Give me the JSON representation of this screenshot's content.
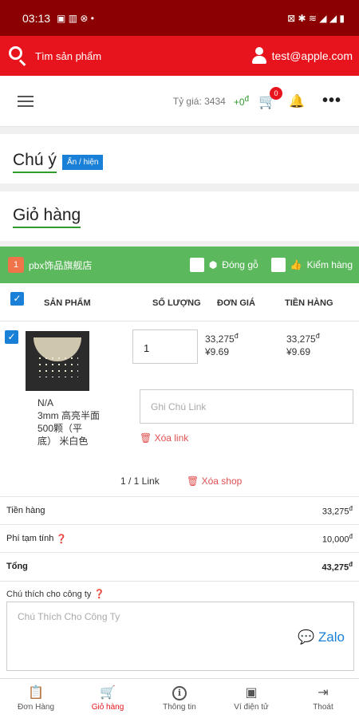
{
  "status_bar": {
    "time": "03:13",
    "icons_left": "▣ ▥ ⊗ •",
    "icons_right": "⊠ ✱ ≋ ◢ ◢ ▮"
  },
  "search": {
    "placeholder": "Tìm sản phẩm",
    "user_email": "test@apple.com"
  },
  "navbar": {
    "exchange_rate": "Tỷ giá: 3434",
    "balance": "+0",
    "balance_unit": "đ",
    "cart_count": "0"
  },
  "attention": {
    "title": "Chú ý",
    "toggle_label": "Ẩn / hiện"
  },
  "cart_title": "Giỏ hàng",
  "shop": {
    "index": "1",
    "name": "pbx饰品旗舰店",
    "wood_pack_label": "Đóng gỗ",
    "inspect_label": "Kiểm hàng"
  },
  "table": {
    "col_product": "SẢN PHẨM",
    "col_qty": "SỐ LƯỢNG",
    "col_unit_price": "ĐƠN GIÁ",
    "col_amount": "TIỀN HÀNG"
  },
  "item": {
    "variant_line1": "N/A",
    "variant_line2": "3mm 高亮半面 500颗（平底） 米白色",
    "quantity": "1",
    "unit_price_vnd": "33,275",
    "unit_price_cny": "¥9.69",
    "amount_vnd": "33,275",
    "amount_cny": "¥9.69",
    "note_placeholder": "Ghi Chú Link",
    "delete_link_label": "Xóa link"
  },
  "shop_footer": {
    "link_count": "1 / 1 Link",
    "delete_shop_label": "Xóa shop"
  },
  "summary": {
    "goods_label": "Tiền hàng",
    "goods_value": "33,275",
    "fee_label": "Phí tạm tính",
    "fee_value": "10,000",
    "total_label": "Tổng",
    "total_value": "43,275",
    "currency_sup": "đ"
  },
  "company_note": {
    "label": "Chú thích cho công ty",
    "placeholder": "Chú Thích Cho Công Ty",
    "zalo_label": "Zalo"
  },
  "bottom_nav": [
    {
      "label": "Đơn Hàng",
      "icon": "clipboard-icon"
    },
    {
      "label": "Giỏ hàng",
      "icon": "cart-icon"
    },
    {
      "label": "Thông tin",
      "icon": "info-icon"
    },
    {
      "label": "Ví điện tử",
      "icon": "wallet-icon"
    },
    {
      "label": "Thoát",
      "icon": "logout-icon"
    }
  ]
}
